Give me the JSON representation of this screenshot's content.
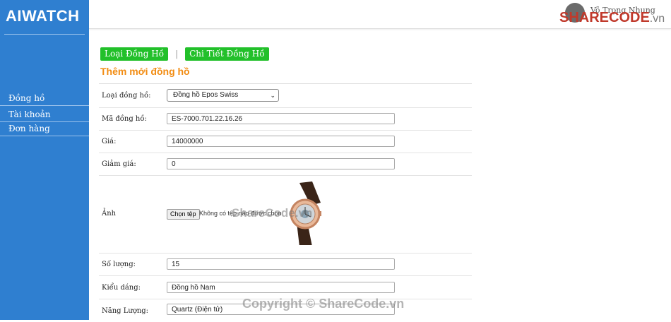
{
  "app": {
    "logo_text": "AIWATCH"
  },
  "sidebar": {
    "items": [
      {
        "label": "Đồng hồ"
      },
      {
        "label": "Tài khoản"
      },
      {
        "label": "Đơn hàng"
      }
    ]
  },
  "header": {
    "user_name": "Võ Trọng Nhung",
    "brand_primary": "SHARECODE",
    "brand_suffix": ".vn"
  },
  "tabs": [
    {
      "label": "Loại Đồng Hồ"
    },
    {
      "label": "Chi Tiết Đồng Hồ"
    }
  ],
  "tab_separator": "|",
  "page_title": "Thêm mới đồng hồ",
  "form": {
    "loai": {
      "label": "Loại đồng hồ:",
      "value": "Đồng hồ Epos Swiss"
    },
    "ma": {
      "label": "Mã đồng hồ:",
      "value": "ES-7000.701.22.16.26"
    },
    "gia": {
      "label": "Giá:",
      "value": "14000000"
    },
    "giamgia": {
      "label": "Giảm giá:",
      "value": "0"
    },
    "anh": {
      "label": "Ảnh",
      "file_button": "Chọn tệp",
      "file_text": "Không có tệp nào được chọn"
    },
    "soluong": {
      "label": "Số lượng:",
      "value": "15"
    },
    "kieudang": {
      "label": "Kiểu dáng:",
      "value": "Đồng hồ Nam"
    },
    "nangluong": {
      "label": "Năng Lượng:",
      "value": "Quartz (Điện tử)"
    }
  },
  "watermarks": {
    "center": "ShareCode.vn",
    "bottom": "Copyright © ShareCode.vn"
  },
  "colors": {
    "sidebar": "#2f7fd0",
    "tab": "#22c02a",
    "title": "#f28c12"
  }
}
